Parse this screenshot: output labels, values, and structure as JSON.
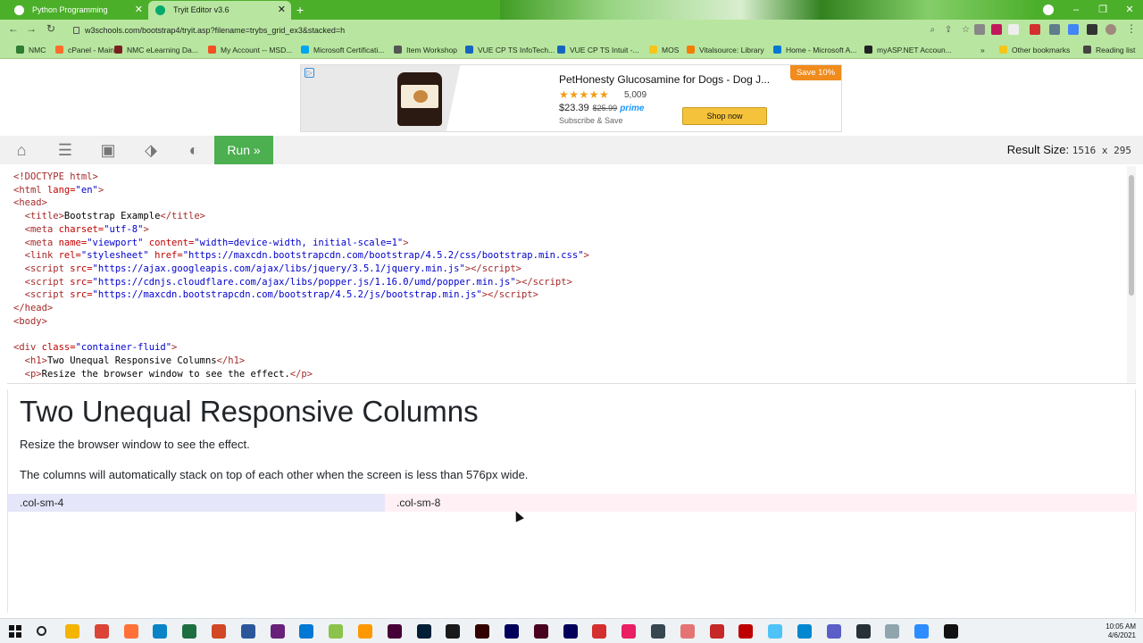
{
  "browser": {
    "tabs": [
      {
        "label": "Python Programming",
        "active": false
      },
      {
        "label": "Tryit Editor v3.6",
        "active": true
      }
    ],
    "url": "w3schools.com/bootstrap4/tryit.asp?filename=trybs_grid_ex3&stacked=h",
    "bookmarks": [
      {
        "label": "NMC",
        "color": "#2e7d32"
      },
      {
        "label": "cPanel - Main",
        "color": "#ff6c2c"
      },
      {
        "label": "NMC eLearning Da...",
        "color": "#7a1f1f"
      },
      {
        "label": "My Account -- MSD...",
        "color": "#f25022"
      },
      {
        "label": "Microsoft Certificati...",
        "color": "#00a4ef"
      },
      {
        "label": "Item Workshop",
        "color": "#555555"
      },
      {
        "label": "VUE CP TS InfoTech...",
        "color": "#1565c0"
      },
      {
        "label": "VUE CP TS Intuit -...",
        "color": "#1565c0"
      },
      {
        "label": "MOS",
        "color": "#f5c518"
      },
      {
        "label": "Vitalsource: Library",
        "color": "#f57c00"
      },
      {
        "label": "Home - Microsoft A...",
        "color": "#0078d4"
      },
      {
        "label": "myASP.NET Accoun...",
        "color": "#222222"
      },
      {
        "label": "Other bookmarks",
        "color": "#f5c518"
      },
      {
        "label": "Reading list",
        "color": "#444444"
      }
    ]
  },
  "ad": {
    "title": "PetHonesty Glucosamine for Dogs - Dog J...",
    "stars": "★★★★★",
    "reviews": "5,009",
    "price": "$23.39",
    "old_price": "$25.99",
    "prime": "prime",
    "subscribe": "Subscribe & Save",
    "shop_button": "Shop now",
    "badge": "Save 10%"
  },
  "tryit": {
    "run_label": "Run »",
    "result_size_label": "Result Size:",
    "result_size_value": "1516 x 295"
  },
  "result": {
    "heading": "Two Unequal Responsive Columns",
    "para1": "Resize the browser window to see the effect.",
    "para2": "The columns will automatically stack on top of each other when the screen is less than 576px wide.",
    "col1": ".col-sm-4",
    "col2": ".col-sm-8"
  },
  "clock": {
    "time": "10:05 AM",
    "date": "4/6/2021"
  },
  "taskbar_apps": [
    {
      "name": "file-explorer",
      "color": "#f4b400"
    },
    {
      "name": "chrome",
      "color": "#db4437"
    },
    {
      "name": "firefox",
      "color": "#ff7139"
    },
    {
      "name": "edge",
      "color": "#0a84c6"
    },
    {
      "name": "excel",
      "color": "#1d6f42"
    },
    {
      "name": "powerpoint",
      "color": "#d24726"
    },
    {
      "name": "word",
      "color": "#2b579a"
    },
    {
      "name": "visual-studio",
      "color": "#68217a"
    },
    {
      "name": "vs-code",
      "color": "#0078d4"
    },
    {
      "name": "notepad-plus",
      "color": "#8bc34a"
    },
    {
      "name": "sublime",
      "color": "#ff9800"
    },
    {
      "name": "dreamweaver",
      "color": "#470137"
    },
    {
      "name": "photoshop",
      "color": "#001e36"
    },
    {
      "name": "bridge",
      "color": "#1a1a1a"
    },
    {
      "name": "illustrator",
      "color": "#330000"
    },
    {
      "name": "animate",
      "color": "#00005b"
    },
    {
      "name": "indesign",
      "color": "#49021f"
    },
    {
      "name": "after-effects",
      "color": "#00005b"
    },
    {
      "name": "acrobat",
      "color": "#d32f2f"
    },
    {
      "name": "paint",
      "color": "#e91e63"
    },
    {
      "name": "terminal-alt",
      "color": "#37474f"
    },
    {
      "name": "snipping",
      "color": "#e57373"
    },
    {
      "name": "bug-tool",
      "color": "#c62828"
    },
    {
      "name": "filezilla",
      "color": "#bf0000"
    },
    {
      "name": "notepad",
      "color": "#4fc3f7"
    },
    {
      "name": "globe",
      "color": "#0288d1"
    },
    {
      "name": "teams",
      "color": "#5b5fc7"
    },
    {
      "name": "headset",
      "color": "#263238"
    },
    {
      "name": "browser-alt",
      "color": "#90a4ae"
    },
    {
      "name": "zoom",
      "color": "#2d8cff"
    },
    {
      "name": "cmd",
      "color": "#111111"
    }
  ]
}
